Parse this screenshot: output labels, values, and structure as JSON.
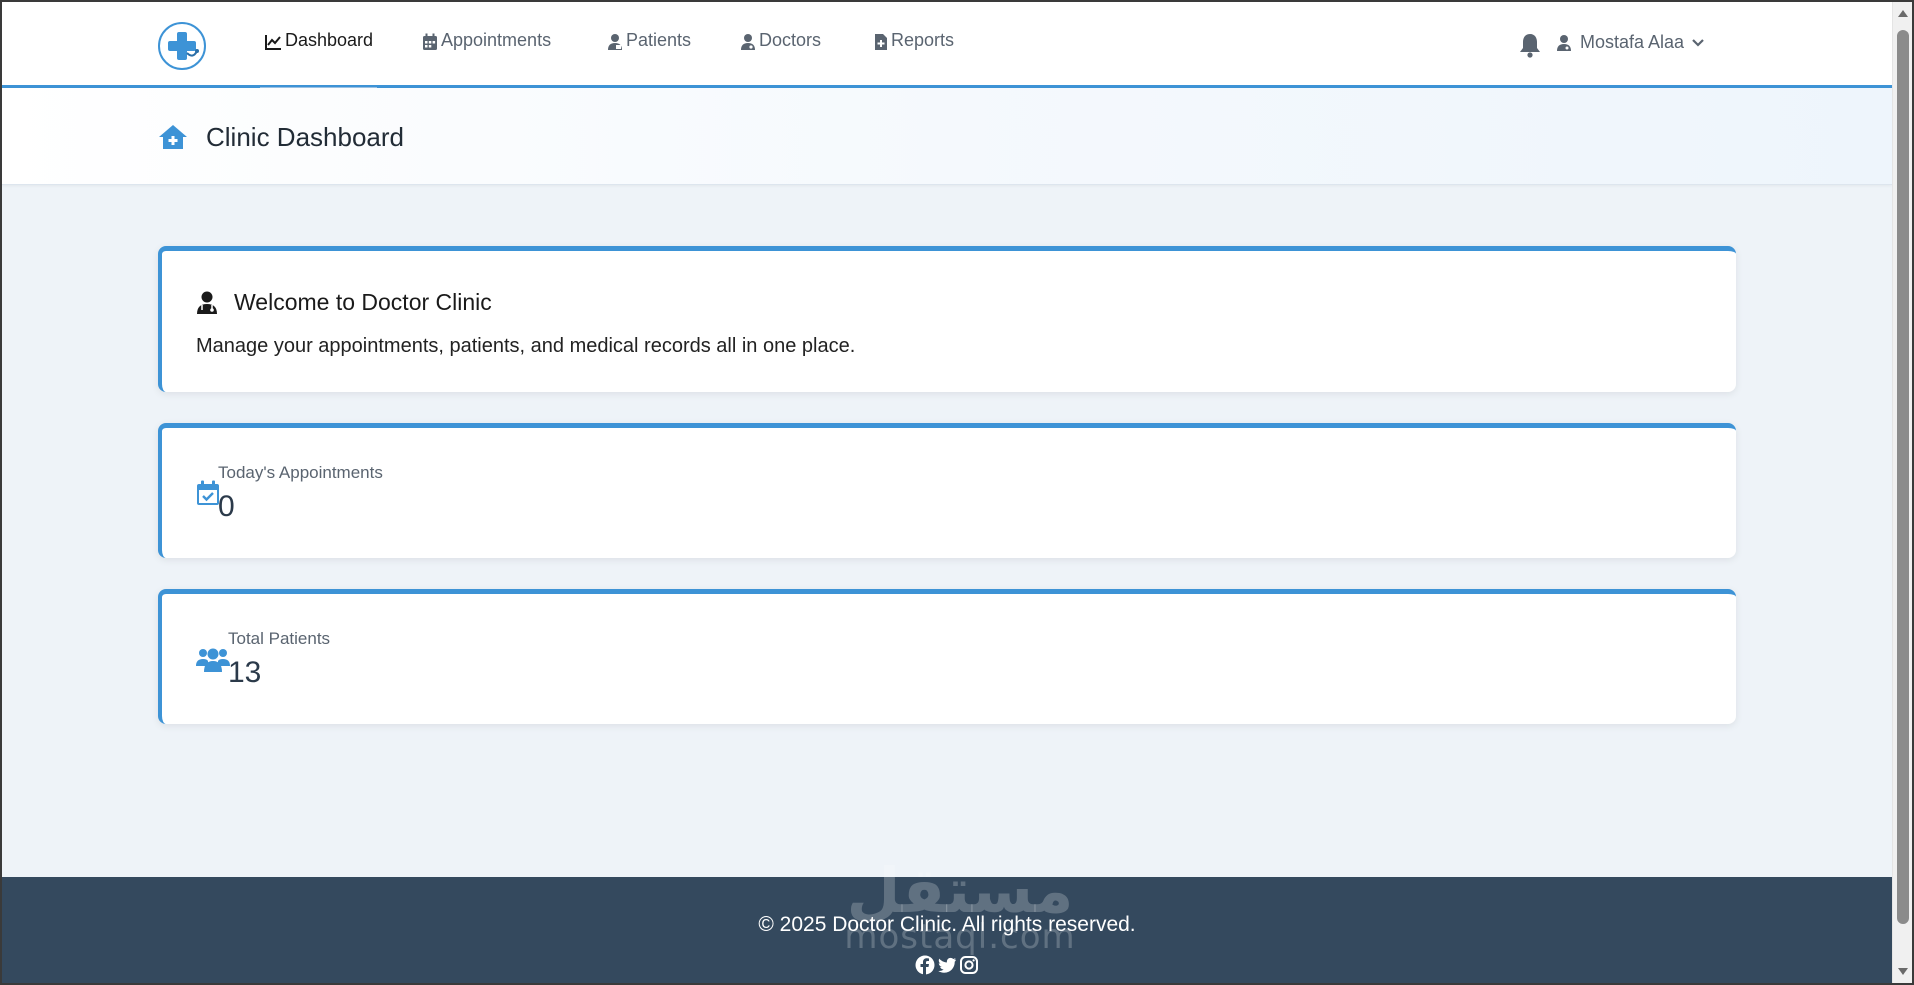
{
  "navbar": {
    "links": [
      {
        "label": "Dashboard",
        "icon": "chart-line-icon",
        "active": true
      },
      {
        "label": "Appointments",
        "icon": "calendar-icon",
        "active": false
      },
      {
        "label": "Patients",
        "icon": "patient-icon",
        "active": false
      },
      {
        "label": "Doctors",
        "icon": "doctor-icon",
        "active": false
      },
      {
        "label": "Reports",
        "icon": "file-medical-icon",
        "active": false
      }
    ],
    "user_name": "Mostafa Alaa"
  },
  "page_header": {
    "title": "Clinic Dashboard"
  },
  "welcome": {
    "title": "Welcome to Doctor Clinic",
    "text": "Manage your appointments, patients, and medical records all in one place."
  },
  "stats": {
    "appointments": {
      "label": "Today's Appointments",
      "value": "0"
    },
    "patients": {
      "label": "Total Patients",
      "value": "13"
    }
  },
  "footer": {
    "copyright": "© 2025 Doctor Clinic. All rights reserved."
  },
  "watermark": {
    "arabic": "مستقل",
    "latin": "mostaql.com"
  },
  "colors": {
    "accent": "#3d93d6",
    "footer_bg": "#34495e",
    "page_bg": "#eef3f8"
  }
}
